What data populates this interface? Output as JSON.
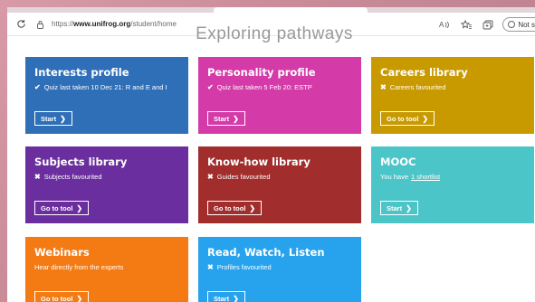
{
  "browser": {
    "url_prefix": "https://",
    "url_host": "www.unifrog.org",
    "url_path": "/student/home",
    "sync_label": "Not s"
  },
  "page": {
    "heading": "Exploring pathways"
  },
  "cards": [
    {
      "title": "Interests profile",
      "info_mark": "✔",
      "info": "Quiz last taken 10 Dec 21: R and E and I",
      "button": "Start",
      "color": "#2f6fb8"
    },
    {
      "title": "Personality profile",
      "info_mark": "✔",
      "info": "Quiz last taken 5 Feb 20: ESTP",
      "button": "Start",
      "color": "#d43aa8"
    },
    {
      "title": "Careers library",
      "info_mark": "✖",
      "info": "Careers favourited",
      "button": "Go to tool",
      "color": "#c99a00"
    },
    {
      "title": "Subjects library",
      "info_mark": "✖",
      "info": "Subjects favourited",
      "button": "Go to tool",
      "color": "#6a2e9e"
    },
    {
      "title": "Know-how library",
      "info_mark": "✖",
      "info": "Guides favourited",
      "button": "Go to tool",
      "color": "#a12d2d"
    },
    {
      "title": "MOOC",
      "info_prefix": "You have",
      "info_link": "1 shortlist",
      "button": "Start",
      "color": "#4cc5c8"
    },
    {
      "title": "Webinars",
      "info": "Hear directly from the experts",
      "button": "Go to tool",
      "color": "#f47b14"
    },
    {
      "title": "Read, Watch, Listen",
      "info_mark": "✖",
      "info": "Profiles favourited",
      "button": "Start",
      "color": "#27a3ee"
    }
  ],
  "icons": {
    "refresh": "refresh-icon",
    "lock": "lock-icon",
    "read_aloud": "read-aloud-icon",
    "favorites": "favorites-icon",
    "collections": "collections-icon"
  }
}
